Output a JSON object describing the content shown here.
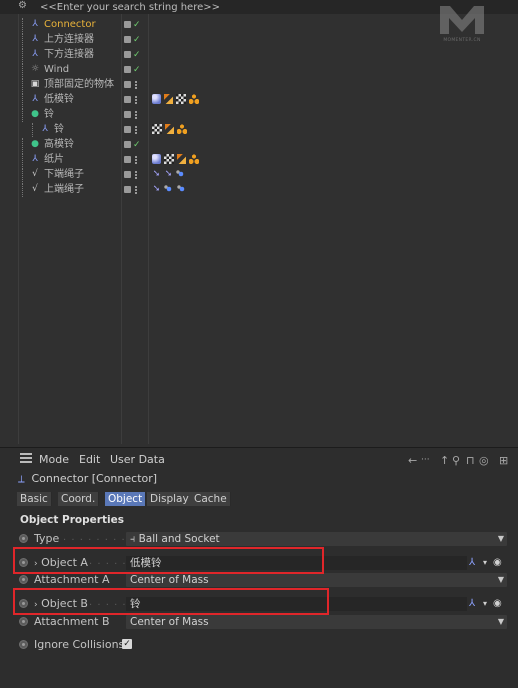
{
  "object_manager": {
    "search_placeholder": "<<Enter your search string here>>",
    "logo_text": "MOMENTER.CN",
    "objects": [
      {
        "name": "Connector",
        "icon": "connector-icon",
        "color": "#e8b23a",
        "indent": 1,
        "tags": []
      },
      {
        "name": "上方连接器",
        "icon": "connector-icon",
        "color": "#b8b8b8",
        "indent": 1,
        "tags": []
      },
      {
        "name": "下方连接器",
        "icon": "connector-icon",
        "color": "#b8b8b8",
        "indent": 1,
        "tags": []
      },
      {
        "name": "Wind",
        "icon": "wind-icon",
        "color": "#b8b8b8",
        "indent": 1,
        "tags": []
      },
      {
        "name": "顶部固定的物体",
        "icon": "null-icon",
        "color": "#b8b8b8",
        "indent": 1,
        "tags": []
      },
      {
        "name": "低模铃",
        "icon": "mesh-icon",
        "color": "#b8b8b8",
        "indent": 1,
        "tags": [
          "dynamics",
          "style",
          "checker",
          "triangles"
        ]
      },
      {
        "name": "铃",
        "icon": "group-icon",
        "color": "#b8b8b8",
        "indent": 1,
        "tags": []
      },
      {
        "name": "铃",
        "icon": "mesh-icon",
        "color": "#b8b8b8",
        "indent": 2,
        "tags": [
          "checker",
          "style",
          "triangles"
        ]
      },
      {
        "name": "高模铃",
        "icon": "group-icon",
        "color": "#b8b8b8",
        "indent": 1,
        "tags": []
      },
      {
        "name": "纸片",
        "icon": "mesh-icon",
        "color": "#b8b8b8",
        "indent": 1,
        "tags": [
          "dynamics",
          "checker",
          "style",
          "triangles"
        ]
      },
      {
        "name": "下端绳子",
        "icon": "spline-icon",
        "color": "#b8b8b8",
        "indent": 1,
        "tags": [
          "arrow",
          "arrow",
          "blue"
        ]
      },
      {
        "name": "上端绳子",
        "icon": "spline-icon",
        "color": "#b8b8b8",
        "indent": 1,
        "tags": [
          "arrow",
          "blue",
          "blue"
        ]
      }
    ]
  },
  "attribute_manager": {
    "menu": {
      "mode": "Mode",
      "edit": "Edit",
      "user_data": "User Data"
    },
    "title": "Connector [Connector]",
    "tabs": [
      {
        "label": "Basic",
        "active": false
      },
      {
        "label": "Coord.",
        "active": false
      },
      {
        "label": "Object",
        "active": true
      },
      {
        "label": "Display",
        "active": false
      },
      {
        "label": "Cache",
        "active": false
      }
    ],
    "section_title": "Object Properties",
    "properties": {
      "type": {
        "label": "Type",
        "value": "Ball and Socket"
      },
      "object_a": {
        "label": "Object A",
        "value": "低模铃"
      },
      "attachment_a": {
        "label": "Attachment A",
        "value": "Center of Mass"
      },
      "object_b": {
        "label": "Object B",
        "value": "铃"
      },
      "attachment_b": {
        "label": "Attachment B",
        "value": "Center of Mass"
      },
      "ignore_collisions": {
        "label": "Ignore Collisions",
        "checked": true
      }
    }
  },
  "colors": {
    "highlight_box": "#e0262a",
    "active_tab": "#5a78b8",
    "selected_object": "#e8b23a"
  }
}
